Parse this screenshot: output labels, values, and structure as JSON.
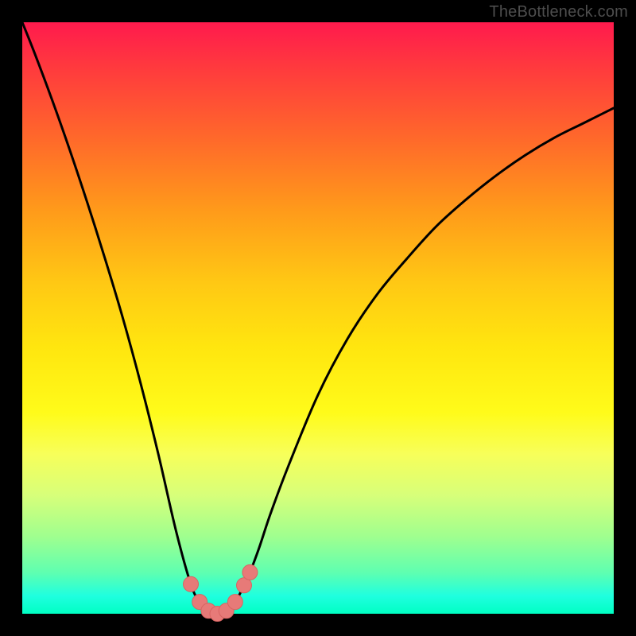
{
  "watermark": "TheBottleneck.com",
  "colors": {
    "border": "#000000",
    "curve": "#000000",
    "marker_fill": "#e77a78",
    "marker_stroke": "#d86462",
    "gradient_top": "#ff1a4d",
    "gradient_bottom": "#00ffc3"
  },
  "chart_data": {
    "type": "line",
    "title": "",
    "xlabel": "",
    "ylabel": "",
    "xlim": [
      0,
      100
    ],
    "ylim": [
      0,
      100
    ],
    "x": [
      0,
      2,
      5,
      8,
      11,
      14,
      17,
      20,
      23,
      26,
      28.5,
      30,
      31.5,
      33,
      34.5,
      36,
      37.5,
      38.5,
      40,
      42,
      45,
      50,
      55,
      60,
      65,
      70,
      75,
      80,
      85,
      90,
      95,
      100
    ],
    "y": [
      100,
      95,
      87,
      78.5,
      69.5,
      60,
      50,
      39,
      27,
      14,
      5,
      2,
      0.5,
      0,
      0.5,
      2,
      4.8,
      7,
      11,
      17,
      25,
      37,
      46.5,
      54,
      60,
      65.5,
      70,
      74,
      77.5,
      80.5,
      83,
      85.5
    ],
    "series_name": "bottleneck-curve",
    "optimal_markers": [
      {
        "x": 28.5,
        "y": 5
      },
      {
        "x": 30.0,
        "y": 2
      },
      {
        "x": 31.5,
        "y": 0.5
      },
      {
        "x": 33.0,
        "y": 0
      },
      {
        "x": 34.5,
        "y": 0.5
      },
      {
        "x": 36.0,
        "y": 2
      },
      {
        "x": 37.5,
        "y": 4.8
      },
      {
        "x": 38.5,
        "y": 7
      }
    ],
    "notes": "V-shaped bottleneck curve over rainbow heatmap background; minimum (optimal region) near x≈33; salmon markers highlight the low-bottleneck band."
  }
}
